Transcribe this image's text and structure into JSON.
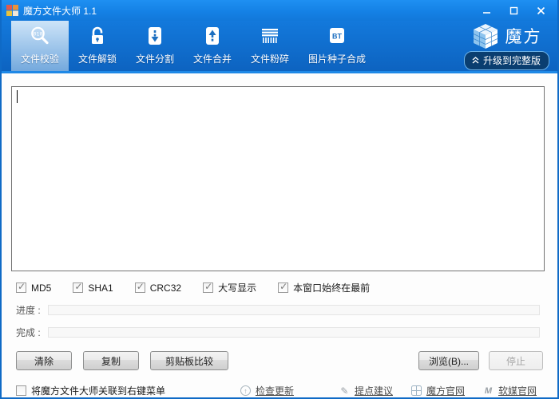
{
  "colors": {
    "titlebar_blue": "#1480e4",
    "toolbar_blue_top": "#1379dc",
    "toolbar_blue_bottom": "#0d63c0",
    "selected_tab_highlight": "#9cc4ea",
    "accent_line": "#1e88e6",
    "window_border": "#0f6ac6",
    "icon_glyph_blue": "#1d6fc0",
    "upgrade_pill_bg": "#0a3e70",
    "upgrade_pill_border": "#6ab1e8"
  },
  "window": {
    "title": "魔方文件大师 1.1"
  },
  "toolbar": {
    "items": [
      {
        "label": "文件校验",
        "selected": true,
        "icon_text": "010"
      },
      {
        "label": "文件解锁",
        "selected": false
      },
      {
        "label": "文件分割",
        "selected": false
      },
      {
        "label": "文件合并",
        "selected": false
      },
      {
        "label": "文件粉碎",
        "selected": false
      },
      {
        "label": "图片种子合成",
        "selected": false,
        "badge": "BT"
      }
    ],
    "brand_name": "魔方",
    "upgrade_label": "升级到完整版"
  },
  "main": {
    "file_area_value": "",
    "checkboxes": [
      {
        "label": "MD5",
        "checked": true
      },
      {
        "label": "SHA1",
        "checked": true
      },
      {
        "label": "CRC32",
        "checked": true
      },
      {
        "label": "大写显示",
        "checked": true
      },
      {
        "label": "本窗口始终在最前",
        "checked": true
      }
    ],
    "progress_label": "进度 :",
    "complete_label": "完成 :",
    "buttons": {
      "clear": "清除",
      "copy": "复制",
      "clipboard_compare": "剪贴板比较",
      "browse": "浏览(B)...",
      "stop": {
        "label": "停止",
        "disabled": true
      }
    }
  },
  "footer": {
    "associate_checkbox": {
      "label": "将魔方文件大师关联到右键菜单",
      "checked": false
    },
    "links": [
      {
        "label": "检查更新"
      },
      {
        "label": "提点建议"
      },
      {
        "label": "魔方官网"
      },
      {
        "label": "软媒官网"
      }
    ]
  }
}
